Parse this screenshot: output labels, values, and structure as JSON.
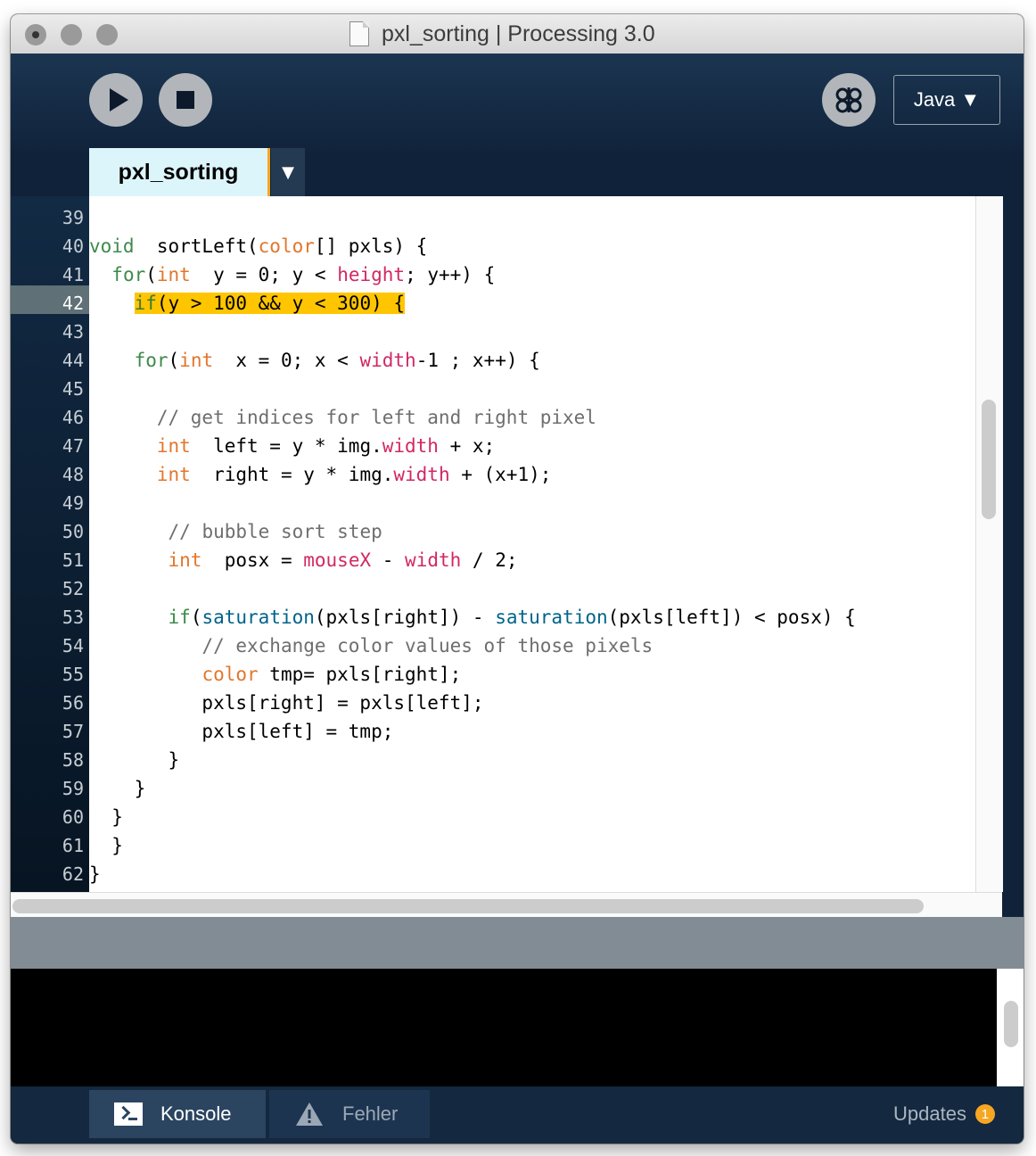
{
  "window": {
    "title": "pxl_sorting | Processing 3.0"
  },
  "toolbar": {
    "mode_label": "Java ▼"
  },
  "tabs": {
    "active_label": "pxl_sorting",
    "menu_glyph": "▼"
  },
  "editor": {
    "highlighted_line": 42,
    "lines": [
      {
        "n": "39",
        "segs": []
      },
      {
        "n": "40",
        "segs": [
          [
            "kw1",
            "void"
          ],
          [
            "",
            "  sortLeft("
          ],
          [
            "kw2",
            "color"
          ],
          [
            "",
            "[] pxls) {"
          ]
        ]
      },
      {
        "n": "41",
        "segs": [
          [
            "",
            "  "
          ],
          [
            "kw1",
            "for"
          ],
          [
            "",
            "("
          ],
          [
            "kw2",
            "int"
          ],
          [
            "",
            "  y = 0; y < "
          ],
          [
            "kw3",
            "height"
          ],
          [
            "",
            "; y++) {"
          ]
        ]
      },
      {
        "n": "42",
        "hl": true,
        "segs": [
          [
            "",
            "    "
          ],
          [
            "kw1",
            "if"
          ],
          [
            "",
            "(y > 100 && y < 300) {"
          ]
        ]
      },
      {
        "n": "43",
        "segs": []
      },
      {
        "n": "44",
        "segs": [
          [
            "",
            "    "
          ],
          [
            "kw1",
            "for"
          ],
          [
            "",
            "("
          ],
          [
            "kw2",
            "int"
          ],
          [
            "",
            "  x = 0; x < "
          ],
          [
            "kw3",
            "width"
          ],
          [
            "",
            "-1 ; x++) {"
          ]
        ]
      },
      {
        "n": "45",
        "segs": []
      },
      {
        "n": "46",
        "segs": [
          [
            "",
            "      "
          ],
          [
            "cm",
            "// get indices for left and right pixel"
          ]
        ]
      },
      {
        "n": "47",
        "segs": [
          [
            "",
            "      "
          ],
          [
            "kw2",
            "int"
          ],
          [
            "",
            "  left = y * img."
          ],
          [
            "kw3",
            "width"
          ],
          [
            "",
            " + x;"
          ]
        ]
      },
      {
        "n": "48",
        "segs": [
          [
            "",
            "      "
          ],
          [
            "kw2",
            "int"
          ],
          [
            "",
            "  right = y * img."
          ],
          [
            "kw3",
            "width"
          ],
          [
            "",
            " + (x+1);"
          ]
        ]
      },
      {
        "n": "49",
        "segs": []
      },
      {
        "n": "50",
        "segs": [
          [
            "",
            "       "
          ],
          [
            "cm",
            "// bubble sort step"
          ]
        ]
      },
      {
        "n": "51",
        "segs": [
          [
            "",
            "       "
          ],
          [
            "kw2",
            "int"
          ],
          [
            "",
            "  posx = "
          ],
          [
            "kw3",
            "mouseX"
          ],
          [
            "",
            " - "
          ],
          [
            "kw3",
            "width"
          ],
          [
            "",
            " / 2;"
          ]
        ]
      },
      {
        "n": "52",
        "segs": []
      },
      {
        "n": "53",
        "segs": [
          [
            "",
            "       "
          ],
          [
            "kw1",
            "if"
          ],
          [
            "",
            "("
          ],
          [
            "fn",
            "saturation"
          ],
          [
            "",
            "(pxls[right]) - "
          ],
          [
            "fn",
            "saturation"
          ],
          [
            "",
            "(pxls[left]) < posx) {"
          ]
        ]
      },
      {
        "n": "54",
        "segs": [
          [
            "",
            "          "
          ],
          [
            "cm",
            "// exchange color values of those pixels"
          ]
        ]
      },
      {
        "n": "55",
        "segs": [
          [
            "",
            "          "
          ],
          [
            "kw2",
            "color"
          ],
          [
            "",
            " tmp= pxls[right];"
          ]
        ]
      },
      {
        "n": "56",
        "segs": [
          [
            "",
            "          pxls[right] = pxls[left];"
          ]
        ]
      },
      {
        "n": "57",
        "segs": [
          [
            "",
            "          pxls[left] = tmp;"
          ]
        ]
      },
      {
        "n": "58",
        "segs": [
          [
            "",
            "       }"
          ]
        ]
      },
      {
        "n": "59",
        "segs": [
          [
            "",
            "    }"
          ]
        ]
      },
      {
        "n": "60",
        "segs": [
          [
            "",
            "  }"
          ]
        ]
      },
      {
        "n": "61",
        "segs": [
          [
            "",
            "  }"
          ]
        ]
      },
      {
        "n": "62",
        "segs": [
          [
            "",
            "}"
          ]
        ]
      }
    ]
  },
  "footer": {
    "console_label": "Konsole",
    "errors_label": "Fehler",
    "updates_label": "Updates",
    "updates_count": "1"
  },
  "icons": {
    "run": "play-icon",
    "stop": "stop-icon",
    "debug": "debugger-butterfly-icon",
    "file": "document-icon",
    "console": "terminal-icon",
    "errors": "warning-icon"
  },
  "colors": {
    "keyword": "#3d8a4a",
    "type": "#e2762b",
    "builtin": "#d12864",
    "function": "#00638a",
    "comment": "#6e6e6e",
    "highlight": "#ffc500",
    "accent": "#f5a623"
  }
}
